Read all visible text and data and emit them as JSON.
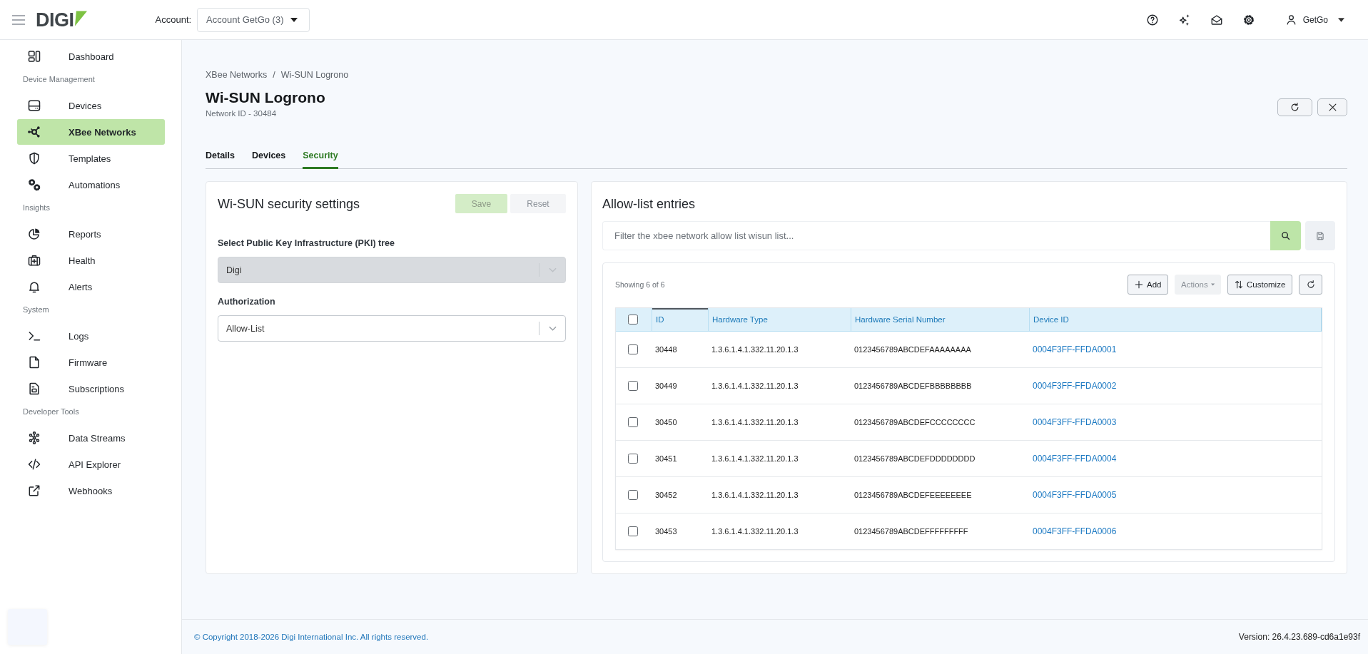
{
  "topbar": {
    "logo_text": "DIGI",
    "account_label": "Account:",
    "account_value": "Account GetGo (3)",
    "user_name": "GetGo"
  },
  "sidebar": {
    "groups": [
      {
        "items": [
          {
            "label": "Dashboard",
            "selected": false
          }
        ]
      },
      {
        "heading": "Device Management",
        "items": [
          {
            "label": "Devices",
            "selected": false
          },
          {
            "label": "XBee Networks",
            "selected": true
          },
          {
            "label": "Templates",
            "selected": false
          },
          {
            "label": "Automations",
            "selected": false
          }
        ]
      },
      {
        "heading": "Insights",
        "items": [
          {
            "label": "Reports",
            "selected": false
          },
          {
            "label": "Health",
            "selected": false
          },
          {
            "label": "Alerts",
            "selected": false
          }
        ]
      },
      {
        "heading": "System",
        "items": [
          {
            "label": "Logs",
            "selected": false
          },
          {
            "label": "Firmware",
            "selected": false
          },
          {
            "label": "Subscriptions",
            "selected": false
          }
        ]
      },
      {
        "heading": "Developer Tools",
        "items": [
          {
            "label": "Data Streams",
            "selected": false
          },
          {
            "label": "API Explorer",
            "selected": false
          },
          {
            "label": "Webhooks",
            "selected": false
          }
        ]
      }
    ]
  },
  "breadcrumb": {
    "items": [
      "XBee Networks",
      "Wi-SUN Logrono"
    ],
    "separator": "/"
  },
  "page": {
    "title": "Wi-SUN Logrono",
    "subtitle": "Network ID - 30484"
  },
  "tabs": [
    {
      "label": "Details",
      "selected": false
    },
    {
      "label": "Devices",
      "selected": false
    },
    {
      "label": "Security",
      "selected": true
    }
  ],
  "security_card": {
    "title": "Wi-SUN security settings",
    "buttons": [
      {
        "label": "Save",
        "kind": "save",
        "disabled": true
      },
      {
        "label": "Reset",
        "kind": "reset",
        "disabled": true
      }
    ],
    "fields": [
      {
        "label": "Select Public Key Infrastructure (PKI) tree",
        "value": "Digi",
        "disabled": true
      },
      {
        "label": "Authorization",
        "value": "Allow-List",
        "disabled": false
      }
    ]
  },
  "allow_list": {
    "title": "Allow-list entries",
    "filter": {
      "placeholder": "Filter the xbee network allow list wisun list..."
    },
    "count": "Showing 6 of 6",
    "toolbar": [
      {
        "label": "Add",
        "kind": "add",
        "disabled": false
      },
      {
        "label": "Actions",
        "kind": "menu",
        "disabled": true
      },
      {
        "label": "Customize",
        "kind": "customize",
        "disabled": false
      },
      {
        "kind": "refresh",
        "disabled": false
      }
    ],
    "table": {
      "select_all_checked": false,
      "columns": [
        {
          "label": "ID",
          "active": true
        },
        {
          "label": "Hardware Type",
          "active": false
        },
        {
          "label": "Hardware Serial Number",
          "active": false
        },
        {
          "label": "Device ID",
          "active": false
        }
      ],
      "rows": [
        {
          "checked": false,
          "id": "30448",
          "hardware_type": "1.3.6.1.4.1.332.11.20.1.3",
          "serial": "0123456789ABCDEFAAAAAAAA",
          "device_id": "0004F3FF-FFDA0001"
        },
        {
          "checked": false,
          "id": "30449",
          "hardware_type": "1.3.6.1.4.1.332.11.20.1.3",
          "serial": "0123456789ABCDEFBBBBBBBB",
          "device_id": "0004F3FF-FFDA0002"
        },
        {
          "checked": false,
          "id": "30450",
          "hardware_type": "1.3.6.1.4.1.332.11.20.1.3",
          "serial": "0123456789ABCDEFCCCCCCCC",
          "device_id": "0004F3FF-FFDA0003"
        },
        {
          "checked": false,
          "id": "30451",
          "hardware_type": "1.3.6.1.4.1.332.11.20.1.3",
          "serial": "0123456789ABCDEFDDDDDDDD",
          "device_id": "0004F3FF-FFDA0004"
        },
        {
          "checked": false,
          "id": "30452",
          "hardware_type": "1.3.6.1.4.1.332.11.20.1.3",
          "serial": "0123456789ABCDEFEEEEEEEE",
          "device_id": "0004F3FF-FFDA0005"
        },
        {
          "checked": false,
          "id": "30453",
          "hardware_type": "1.3.6.1.4.1.332.11.20.1.3",
          "serial": "0123456789ABCDEFFFFFFFFF",
          "device_id": "0004F3FF-FFDA0006"
        }
      ]
    }
  },
  "footer": {
    "copyright": "© Copyright 2018-2026 Digi International Inc. All rights reserved.",
    "version": "Version: 26.4.23.689-cd6a1e93f"
  }
}
